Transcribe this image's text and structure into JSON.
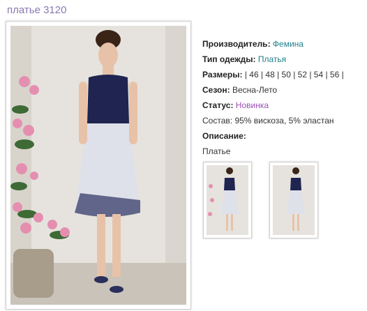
{
  "page": {
    "title": "платье 3120"
  },
  "details": {
    "manufacturer": {
      "label": "Производитель:",
      "value": "Фемина"
    },
    "clothing_type": {
      "label": "Тип одежды:",
      "value": "Платья"
    },
    "sizes": {
      "label": "Размеры:",
      "value": "| 46 | 48 | 50 | 52 | 54 | 56 |"
    },
    "season": {
      "label": "Сезон:",
      "value": "Весна-Лето"
    },
    "status": {
      "label": "Статус:",
      "value": "Новинка"
    },
    "composition": {
      "label": "Состав:",
      "value": "95% вискоза, 5% эластан"
    },
    "description": {
      "label": "Описание:",
      "value": "Платье"
    }
  },
  "colors": {
    "title": "#8a7ab0",
    "link": "#1f7f8c",
    "status_link": "#9b4fb5"
  },
  "thumbnails": [
    {
      "name": "front-view"
    },
    {
      "name": "back-view"
    }
  ]
}
